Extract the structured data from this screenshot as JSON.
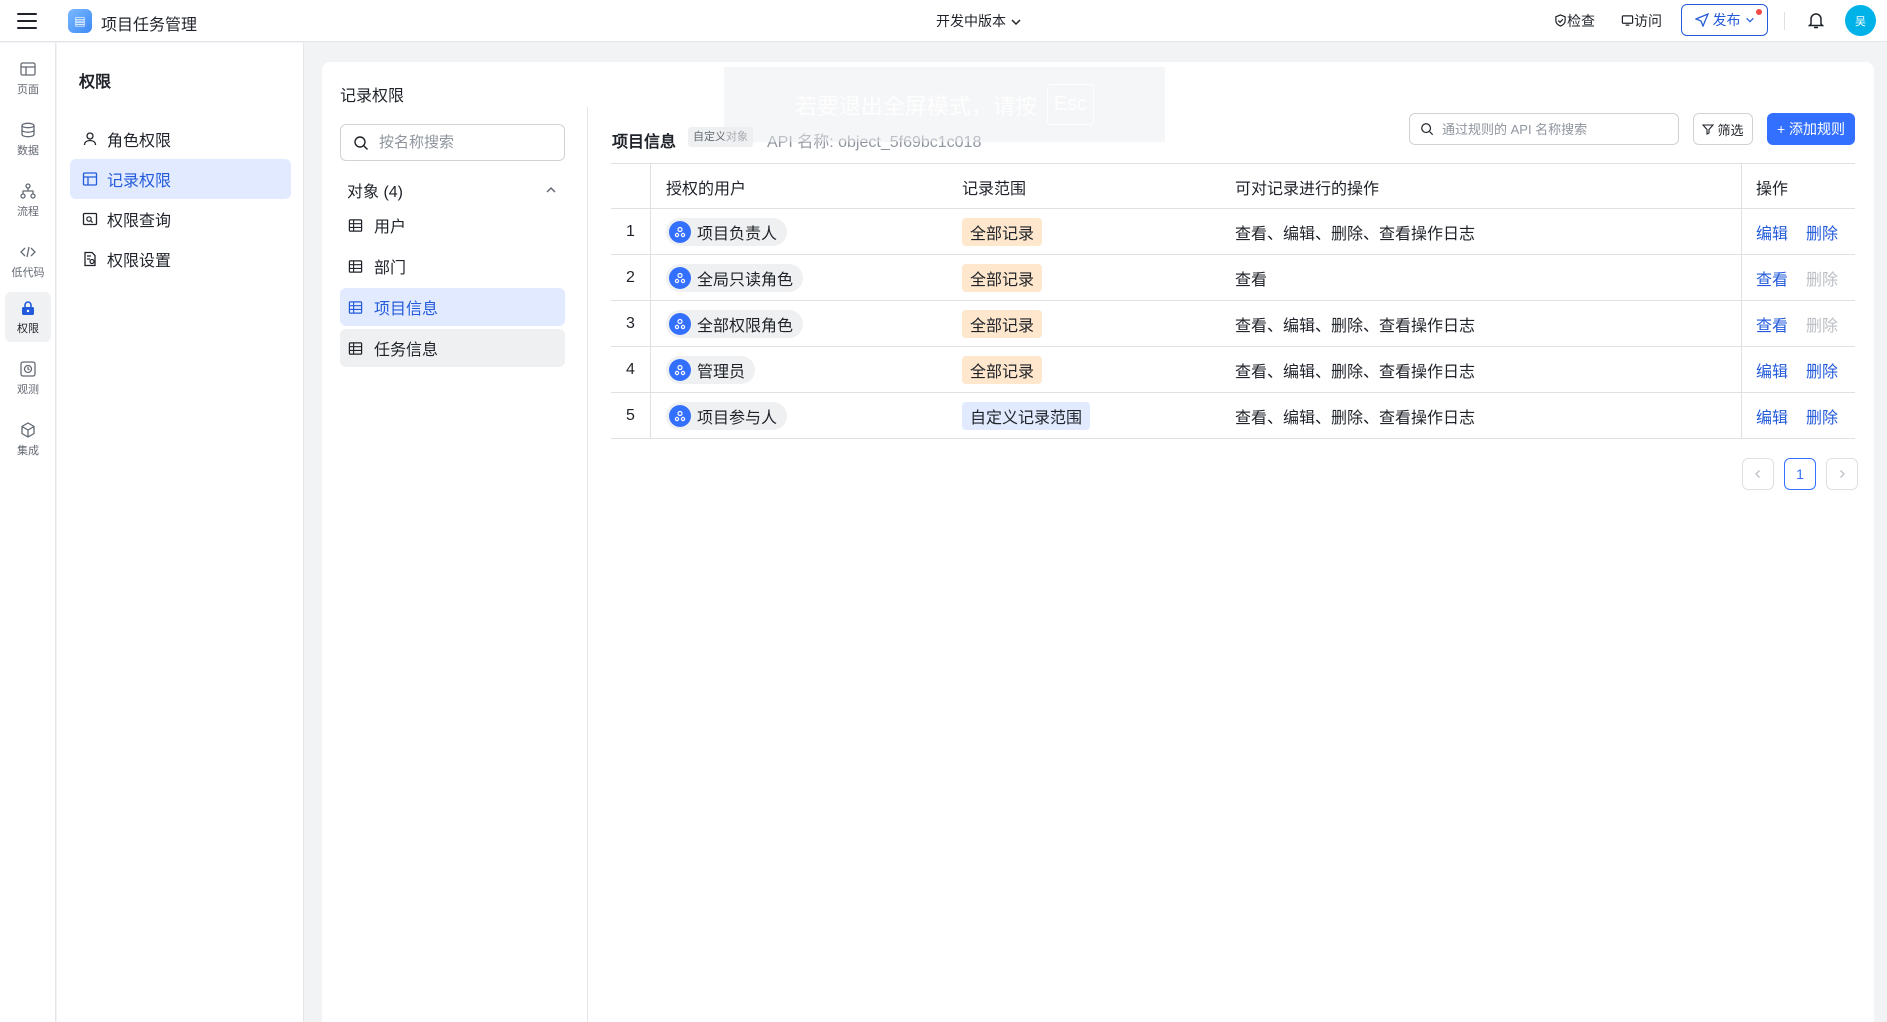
{
  "topbar": {
    "app_title": "项目任务管理",
    "version": "开发中版本",
    "check": "检查",
    "visit": "访问",
    "publish": "发布",
    "avatar_text": "吴"
  },
  "rail": [
    {
      "label": "页面",
      "icon": "page-icon"
    },
    {
      "label": "数据",
      "icon": "database-icon"
    },
    {
      "label": "流程",
      "icon": "flow-icon"
    },
    {
      "label": "低代码",
      "icon": "code-icon"
    },
    {
      "label": "权限",
      "icon": "lock-icon",
      "active": true
    },
    {
      "label": "观测",
      "icon": "monitor-icon"
    },
    {
      "label": "集成",
      "icon": "cube-icon"
    }
  ],
  "subnav": {
    "title": "权限",
    "items": [
      {
        "label": "角色权限",
        "icon": "user-icon"
      },
      {
        "label": "记录权限",
        "icon": "table-icon",
        "active": true
      },
      {
        "label": "权限查询",
        "icon": "query-icon"
      },
      {
        "label": "权限设置",
        "icon": "settings-doc-icon"
      }
    ]
  },
  "card": {
    "title": "记录权限",
    "search_placeholder": "按名称搜索",
    "objects_header": "对象 (4)",
    "objects": [
      {
        "label": "用户"
      },
      {
        "label": "部门"
      },
      {
        "label": "项目信息",
        "active": true
      },
      {
        "label": "任务信息",
        "hover": true
      }
    ]
  },
  "detail": {
    "object_name": "项目信息",
    "tag": "自定义对象",
    "api_name": "API 名称: object_5f69bc1c018",
    "rule_search_placeholder": "通过规则的 API 名称搜索",
    "filter": "筛选",
    "add_rule": "+ 添加规则",
    "columns": [
      "授权的用户",
      "记录范围",
      "可对记录进行的操作",
      "操作"
    ],
    "rows": [
      {
        "idx": "1",
        "user": "项目负责人",
        "scope": "全部记录",
        "ops": "查看、编辑、删除、查看操作日志",
        "a1": "编辑",
        "a2": "删除",
        "a2_disabled": false
      },
      {
        "idx": "2",
        "user": "全局只读角色",
        "scope": "全部记录",
        "ops": "查看",
        "a1": "查看",
        "a2": "删除",
        "a2_disabled": true
      },
      {
        "idx": "3",
        "user": "全部权限角色",
        "scope": "全部记录",
        "ops": "查看、编辑、删除、查看操作日志",
        "a1": "查看",
        "a2": "删除",
        "a2_disabled": true
      },
      {
        "idx": "4",
        "user": "管理员",
        "scope": "全部记录",
        "ops": "查看、编辑、删除、查看操作日志",
        "a1": "编辑",
        "a2": "删除",
        "a2_disabled": false
      },
      {
        "idx": "5",
        "user": "项目参与人",
        "scope": "自定义记录范围",
        "ops": "查看、编辑、删除、查看操作日志",
        "a1": "编辑",
        "a2": "删除",
        "a2_disabled": false
      }
    ],
    "page": "1"
  },
  "overlay": {
    "message": "若要退出全屏模式，请按",
    "key": "Esc"
  }
}
